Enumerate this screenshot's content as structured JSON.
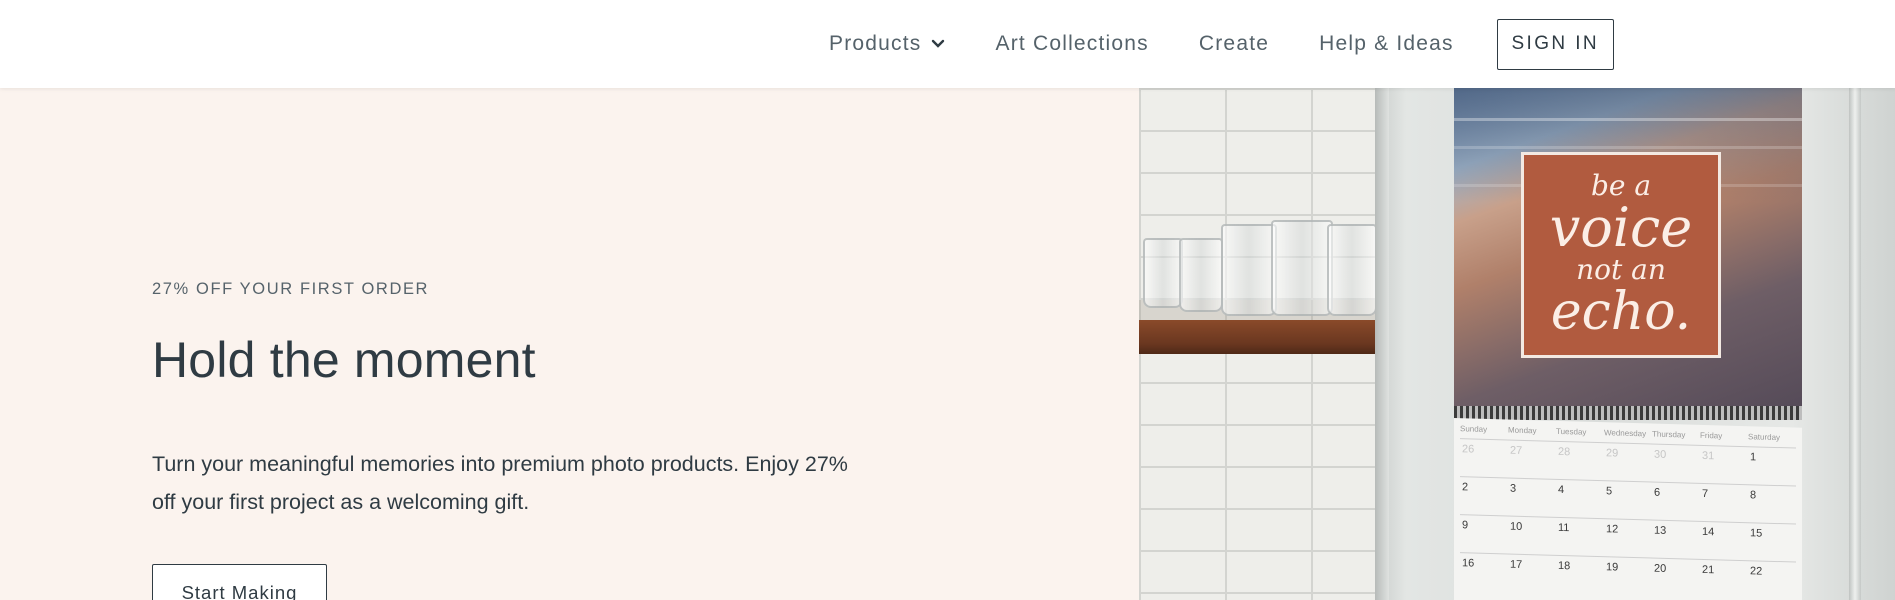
{
  "nav": {
    "products": "Products",
    "art_collections": "Art Collections",
    "create": "Create",
    "help_ideas": "Help & Ideas",
    "sign_in": "SIGN IN"
  },
  "hero": {
    "eyebrow": "27% OFF YOUR FIRST ORDER",
    "headline": "Hold the moment",
    "body": "Turn your meaningful memories into premium photo products. Enjoy 27% off your first project as a welcoming gift.",
    "cta": "Start Making"
  },
  "photo": {
    "quote_line1": "be a",
    "quote_line2": "voice",
    "quote_line3": "not an",
    "quote_line4": "echo.",
    "weekdays": [
      "Sunday",
      "Monday",
      "Tuesday",
      "Wednesday",
      "Thursday",
      "Friday",
      "Saturday"
    ],
    "weeks": [
      [
        "26",
        "27",
        "28",
        "29",
        "30",
        "31",
        "1"
      ],
      [
        "2",
        "3",
        "4",
        "5",
        "6",
        "7",
        "8"
      ],
      [
        "9",
        "10",
        "11",
        "12",
        "13",
        "14",
        "15"
      ],
      [
        "16",
        "17",
        "18",
        "19",
        "20",
        "21",
        "22"
      ]
    ]
  },
  "colors": {
    "hero_bg": "#fbf3ee",
    "text": "#2f3b43",
    "nav_text": "#55626a",
    "quote_card": "#b15b3f"
  }
}
